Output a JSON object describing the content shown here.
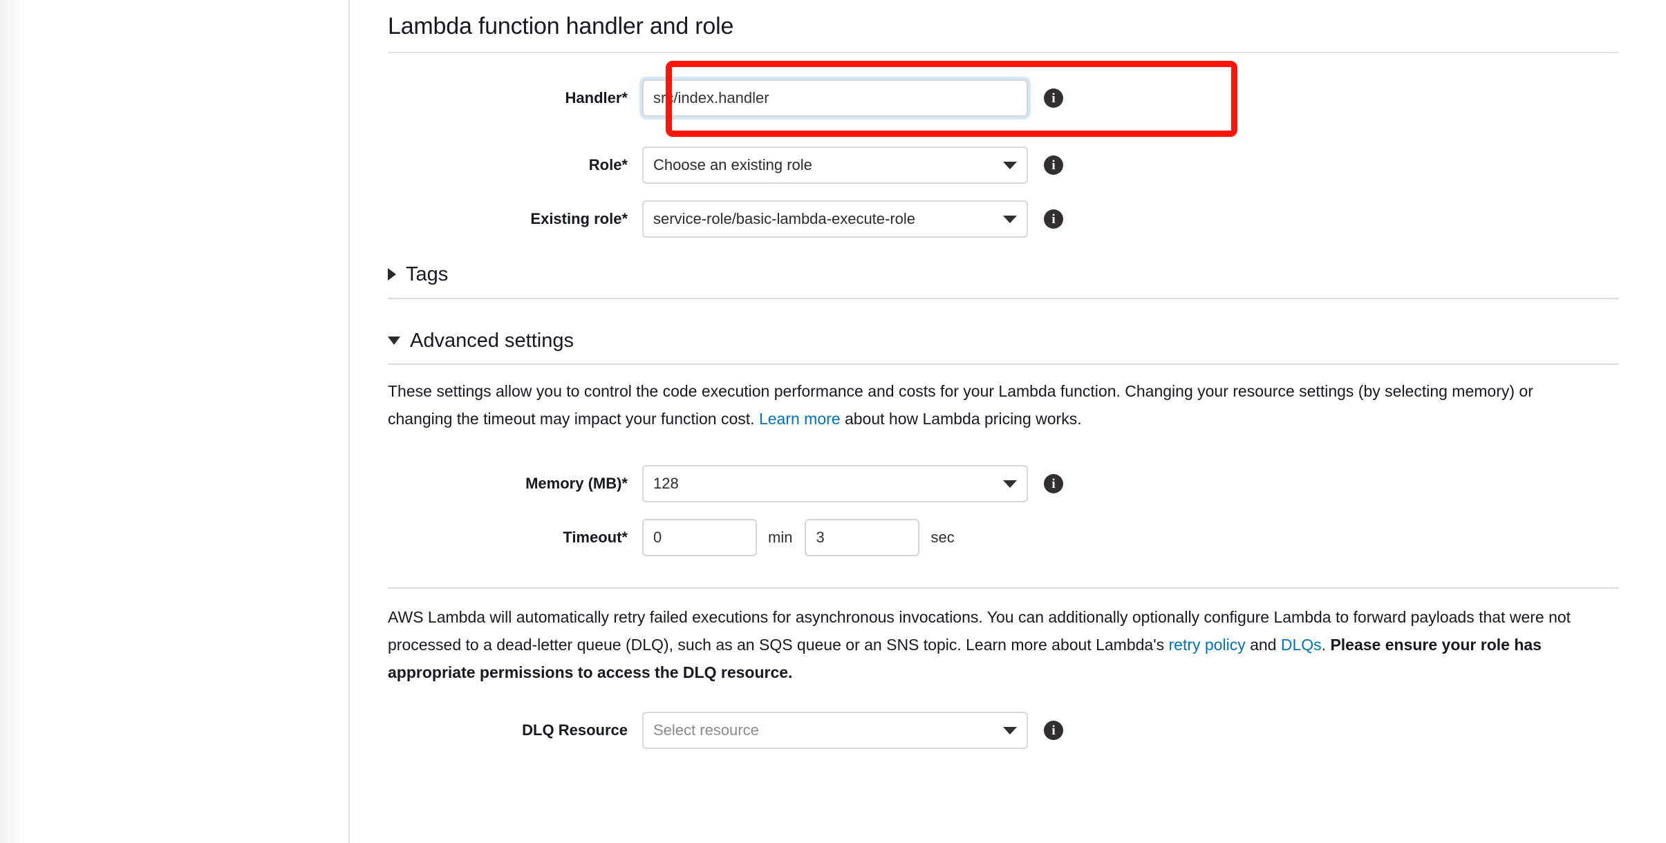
{
  "section": {
    "title": "Lambda function handler and role"
  },
  "fields": {
    "handler": {
      "label": "Handler*",
      "value": "src/index.handler",
      "info": "i"
    },
    "role": {
      "label": "Role*",
      "value": "Choose an existing role",
      "info": "i"
    },
    "existing_role": {
      "label": "Existing role*",
      "value": "service-role/basic-lambda-execute-role",
      "info": "i"
    },
    "memory": {
      "label": "Memory (MB)*",
      "value": "128",
      "info": "i"
    },
    "timeout": {
      "label": "Timeout*",
      "minutes": "0",
      "minutes_unit": "min",
      "seconds": "3",
      "seconds_unit": "sec"
    },
    "dlq_resource": {
      "label": "DLQ Resource",
      "placeholder": "Select resource",
      "info": "i"
    }
  },
  "expanders": {
    "tags": {
      "label": "Tags",
      "state": "collapsed"
    },
    "advanced": {
      "label": "Advanced settings",
      "state": "expanded"
    }
  },
  "paragraphs": {
    "advanced": {
      "part1": "These settings allow you to control the code execution performance and costs for your Lambda function. Changing your resource settings (by selecting memory) or changing the timeout may impact your function cost. ",
      "link": "Learn more",
      "part2": " about how Lambda pricing works."
    },
    "dlq": {
      "part1": "AWS Lambda will automatically retry failed executions for asynchronous invocations. You can additionally optionally configure Lambda to forward payloads that were not processed to a dead-letter queue (DLQ), such as an SQS queue or an SNS topic. Learn more about Lambda's ",
      "link1": "retry policy",
      "mid": " and ",
      "link2": "DLQs",
      "part2": ". ",
      "bold": "Please ensure your role has appropriate permissions to access the DLQ resource."
    }
  },
  "colors": {
    "link": "#0073bb",
    "focus_border": "#5b9dd9",
    "annotation": "#fc1508",
    "text": "#16191f"
  }
}
